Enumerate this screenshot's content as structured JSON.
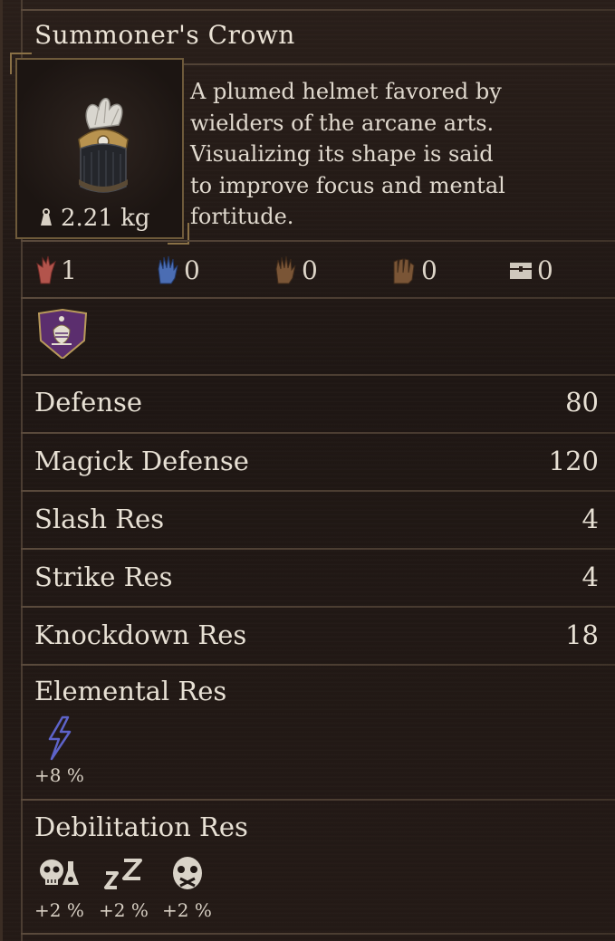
{
  "item": {
    "name": "Summoner's Crown",
    "weight": "2.21 kg",
    "description_lines": [
      "A plumed helmet favored by",
      "wielders of the arcane arts.",
      "Visualizing its shape is said",
      "to improve focus and mental",
      "fortitude."
    ]
  },
  "vocation_counts": [
    {
      "icon": "red-claw-icon",
      "value": "1",
      "color": "#b3544c"
    },
    {
      "icon": "blue-hand-icon",
      "value": "0",
      "color": "#4b6db3"
    },
    {
      "icon": "brown-hand-icon",
      "value": "0",
      "color": "#7a5536"
    },
    {
      "icon": "brown-fist-icon",
      "value": "0",
      "color": "#7a5536"
    },
    {
      "icon": "chest-icon",
      "value": "0",
      "color": "#cfc8bd"
    }
  ],
  "emblem": {
    "icon": "mage-emblem-icon",
    "color": "#5b2e6e"
  },
  "stats": [
    {
      "label": "Defense",
      "value": "80"
    },
    {
      "label": "Magick Defense",
      "value": "120"
    },
    {
      "label": "Slash Res",
      "value": "4"
    },
    {
      "label": "Strike Res",
      "value": "4"
    },
    {
      "label": "Knockdown Res",
      "value": "18"
    }
  ],
  "elemental": {
    "label": "Elemental Res",
    "items": [
      {
        "icon": "lightning-icon",
        "value": "+8 %",
        "color": "#5d63c9"
      }
    ]
  },
  "debilitation": {
    "label": "Debilitation Res",
    "items": [
      {
        "icon": "poison-skull-icon",
        "value": "+2 %"
      },
      {
        "icon": "sleep-icon",
        "value": "+2 %"
      },
      {
        "icon": "silence-mask-icon",
        "value": "+2 %"
      }
    ]
  }
}
